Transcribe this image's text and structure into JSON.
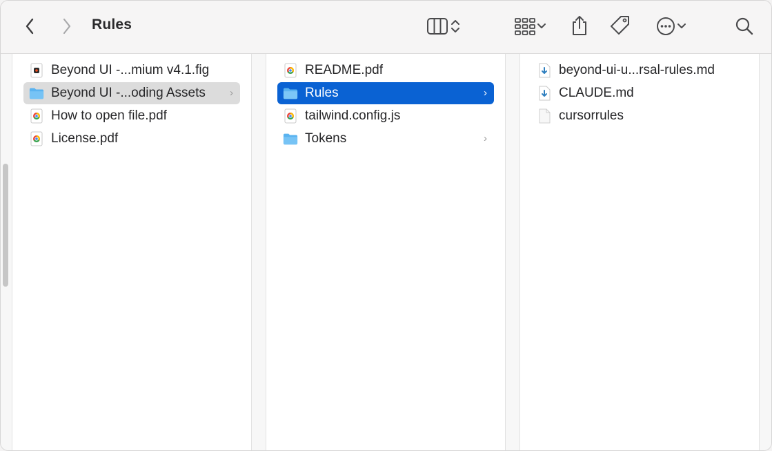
{
  "window": {
    "title": "Rules"
  },
  "toolbar": {
    "back_icon": "chevron-left-icon",
    "forward_icon": "chevron-right-icon",
    "view_icon": "column-view-icon",
    "group_icon": "grid-group-icon",
    "share_icon": "share-icon",
    "tag_icon": "tag-icon",
    "more_icon": "ellipsis-circle-icon",
    "search_icon": "magnifier-icon"
  },
  "columns": [
    {
      "items": [
        {
          "label": "Beyond UI -...mium v4.1.fig",
          "icon": "figma-file-icon",
          "selected": "",
          "has_children": false
        },
        {
          "label": "Beyond UI -...oding Assets",
          "icon": "folder-icon",
          "selected": "inactive",
          "has_children": true
        },
        {
          "label": "How to open file.pdf",
          "icon": "chrome-pdf-icon",
          "selected": "",
          "has_children": false
        },
        {
          "label": "License.pdf",
          "icon": "chrome-pdf-icon",
          "selected": "",
          "has_children": false
        }
      ]
    },
    {
      "items": [
        {
          "label": "README.pdf",
          "icon": "chrome-pdf-icon",
          "selected": "",
          "has_children": false
        },
        {
          "label": "Rules",
          "icon": "folder-icon",
          "selected": "active",
          "has_children": true
        },
        {
          "label": "tailwind.config.js",
          "icon": "chrome-js-icon",
          "selected": "",
          "has_children": false
        },
        {
          "label": "Tokens",
          "icon": "folder-icon",
          "selected": "",
          "has_children": true
        }
      ]
    },
    {
      "items": [
        {
          "label": "beyond-ui-u...rsal-rules.md",
          "icon": "markdown-file-icon",
          "selected": "",
          "has_children": false
        },
        {
          "label": "CLAUDE.md",
          "icon": "markdown-file-icon",
          "selected": "",
          "has_children": false
        },
        {
          "label": "cursorrules",
          "icon": "blank-file-icon",
          "selected": "",
          "has_children": false
        }
      ]
    }
  ],
  "colors": {
    "selection_active": "#0a62d3",
    "selection_inactive": "#dcdcdc",
    "folder": "#5ab3f0"
  }
}
